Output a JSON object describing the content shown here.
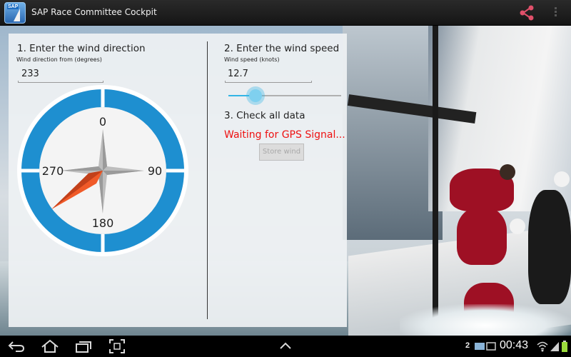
{
  "app": {
    "title": "SAP Race Committee Cockpit",
    "icon_badge": "SAP"
  },
  "wind_direction": {
    "step_title": "1. Enter the wind direction",
    "field_label": "Wind direction from (degrees)",
    "value": "233",
    "compass": {
      "labels": [
        "0",
        "90",
        "180",
        "270"
      ],
      "degrees": 233
    }
  },
  "wind_speed": {
    "step_title": "2. Enter the wind speed",
    "field_label": "Wind speed (knots)",
    "value": "12.7",
    "slider_fraction": 0.24
  },
  "check": {
    "step_title": "3. Check all data",
    "status": "Waiting for GPS Signal...",
    "store_label": "Store wind"
  },
  "status_bar": {
    "time": "00:43",
    "notification_count": "2"
  },
  "colors": {
    "accent": "#33b5e5",
    "compass_ring": "#1e8fd0",
    "needle": "#f05a28",
    "status_error": "#ee1111"
  },
  "icons": [
    "share-icon",
    "overflow-menu-icon",
    "back-icon",
    "home-icon",
    "recent-apps-icon",
    "screenshot-icon",
    "chevron-up-icon",
    "wifi-icon",
    "signal-icon",
    "battery-icon",
    "photo-icon"
  ]
}
